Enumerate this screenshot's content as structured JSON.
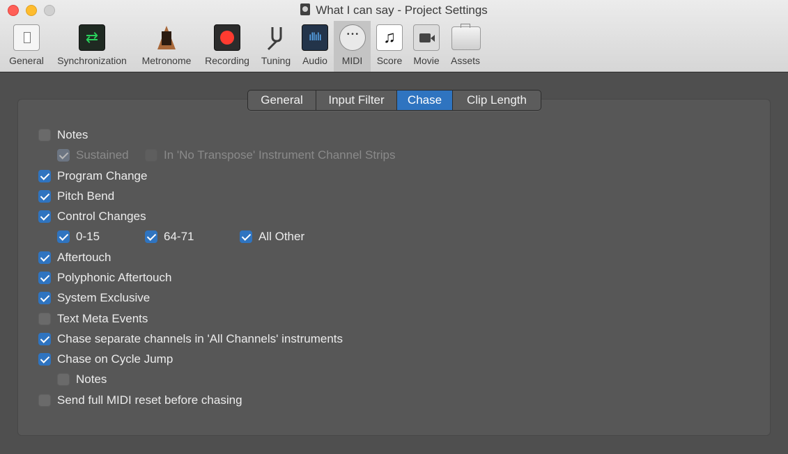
{
  "window": {
    "title": "What I can say - Project Settings"
  },
  "toolbar": {
    "items": [
      {
        "label": "General",
        "icon": "general-icon"
      },
      {
        "label": "Synchronization",
        "icon": "synchronization-icon"
      },
      {
        "label": "Metronome",
        "icon": "metronome-icon"
      },
      {
        "label": "Recording",
        "icon": "record-icon"
      },
      {
        "label": "Tuning",
        "icon": "tuning-fork-icon"
      },
      {
        "label": "Audio",
        "icon": "audio-waveform-icon"
      },
      {
        "label": "MIDI",
        "icon": "midi-connector-icon",
        "active": true
      },
      {
        "label": "Score",
        "icon": "music-note-icon"
      },
      {
        "label": "Movie",
        "icon": "video-camera-icon"
      },
      {
        "label": "Assets",
        "icon": "briefcase-icon"
      }
    ]
  },
  "tabs": [
    {
      "label": "General",
      "active": false
    },
    {
      "label": "Input Filter",
      "active": false
    },
    {
      "label": "Chase",
      "active": true
    },
    {
      "label": "Clip Length",
      "active": false
    }
  ],
  "chase": {
    "notes": {
      "label": "Notes",
      "checked": false
    },
    "sustained": {
      "label": "Sustained",
      "checked": true,
      "enabled": false
    },
    "no_transpose": {
      "label": "In 'No Transpose' Instrument Channel Strips",
      "checked": false,
      "enabled": false
    },
    "program_change": {
      "label": "Program Change",
      "checked": true
    },
    "pitch_bend": {
      "label": "Pitch Bend",
      "checked": true
    },
    "control_changes": {
      "label": "Control Changes",
      "checked": true
    },
    "cc_0_15": {
      "label": "0-15",
      "checked": true
    },
    "cc_64_71": {
      "label": "64-71",
      "checked": true
    },
    "cc_all_other": {
      "label": "All Other",
      "checked": true
    },
    "aftertouch": {
      "label": "Aftertouch",
      "checked": true
    },
    "poly_aftertouch": {
      "label": "Polyphonic Aftertouch",
      "checked": true
    },
    "system_exclusive": {
      "label": "System Exclusive",
      "checked": true
    },
    "text_meta": {
      "label": "Text Meta Events",
      "checked": false
    },
    "separate_channels": {
      "label": "Chase separate channels in 'All Channels' instruments",
      "checked": true
    },
    "cycle_jump": {
      "label": "Chase on Cycle Jump",
      "checked": true
    },
    "cycle_notes": {
      "label": "Notes",
      "checked": false
    },
    "midi_reset": {
      "label": "Send full MIDI reset before chasing",
      "checked": false
    }
  },
  "colors": {
    "accent": "#2f74c0",
    "close": "#ff5f57",
    "minimize": "#febc2e"
  }
}
